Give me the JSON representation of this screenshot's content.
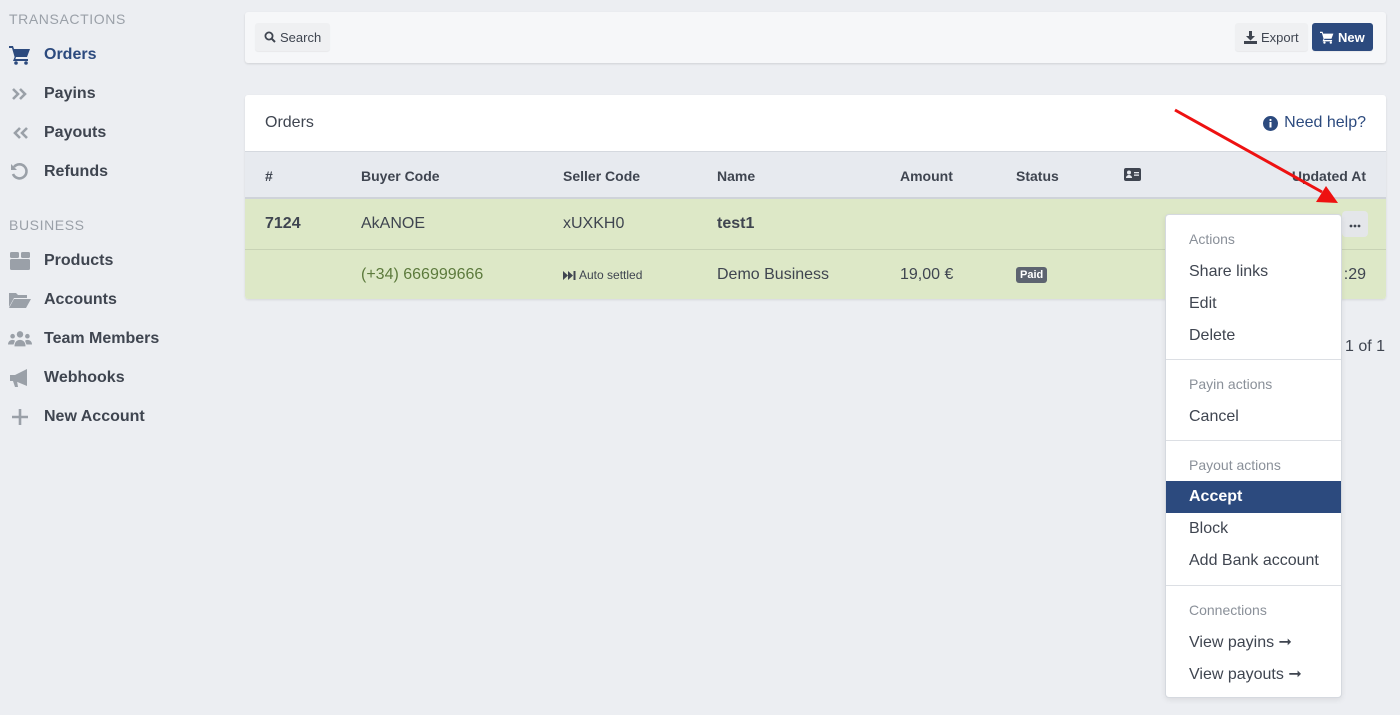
{
  "sidebar": {
    "sections": [
      {
        "title": "TRANSACTIONS",
        "items": [
          {
            "label": "Orders",
            "icon": "cart-icon",
            "active": true
          },
          {
            "label": "Payins",
            "icon": "double-chevron-right-icon"
          },
          {
            "label": "Payouts",
            "icon": "double-chevron-left-icon"
          },
          {
            "label": "Refunds",
            "icon": "undo-icon"
          }
        ]
      },
      {
        "title": "BUSINESS",
        "items": [
          {
            "label": "Products",
            "icon": "box-icon"
          },
          {
            "label": "Accounts",
            "icon": "folder-open-icon"
          },
          {
            "label": "Team Members",
            "icon": "users-icon"
          },
          {
            "label": "Webhooks",
            "icon": "bullhorn-icon"
          },
          {
            "label": "New Account",
            "icon": "plus-icon"
          }
        ]
      }
    ]
  },
  "toolbar": {
    "search_label": "Search",
    "export_label": "Export",
    "new_label": "New"
  },
  "orders": {
    "title": "Orders",
    "help_label": "Need help?",
    "columns": [
      "#",
      "Buyer Code",
      "Seller Code",
      "Name",
      "Amount",
      "Status",
      "",
      "Updated At"
    ],
    "row": {
      "id": "7124",
      "buyer_code": "AkANOE",
      "seller_code": "xUXKH0",
      "name": "test1",
      "buyer_phone": "(+34) 666999666",
      "settlement": "Auto settled",
      "business": "Demo Business",
      "amount": "19,00 €",
      "status": "Paid",
      "updated_at_partial": ":29"
    },
    "pagination": "1 of 1"
  },
  "dropdown": {
    "groups": [
      {
        "header": "Actions",
        "items": [
          "Share links",
          "Edit",
          "Delete"
        ]
      },
      {
        "header": "Payin actions",
        "items": [
          "Cancel"
        ]
      },
      {
        "header": "Payout actions",
        "items": [
          "Accept",
          "Block",
          "Add Bank account"
        ]
      },
      {
        "header": "Connections",
        "items": [
          "View payins ➞",
          "View payouts ➞"
        ]
      }
    ],
    "highlighted": "Accept"
  },
  "colors": {
    "primary": "#2c4a7e",
    "row_success": "#dde8c7",
    "annotation_arrow": "#ee1111"
  }
}
